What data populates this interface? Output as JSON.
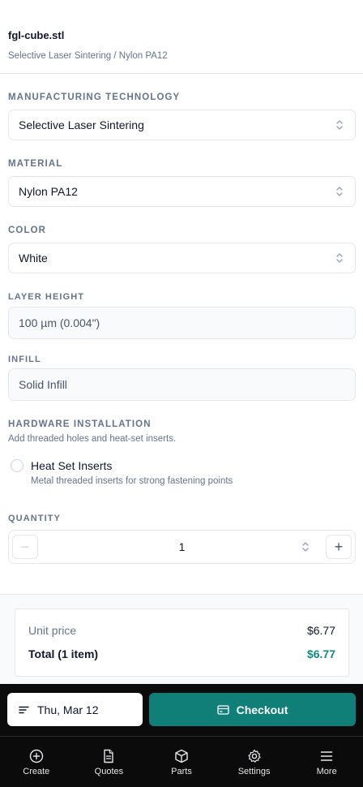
{
  "file": {
    "name": "fgl-cube.stl",
    "subtitle": "Selective Laser Sintering / Nylon PA12"
  },
  "fields": {
    "technology": {
      "label": "MANUFACTURING TECHNOLOGY",
      "value": "Selective Laser Sintering"
    },
    "material": {
      "label": "MATERIAL",
      "value": "Nylon PA12"
    },
    "color": {
      "label": "COLOR",
      "value": "White"
    },
    "layer_height": {
      "label": "LAYER HEIGHT",
      "value": "100 µm (0.004\")"
    },
    "infill": {
      "label": "INFILL",
      "value": "Solid Infill"
    }
  },
  "hardware": {
    "label": "HARDWARE INSTALLATION",
    "help": "Add threaded holes and heat-set inserts.",
    "option_title": "Heat Set Inserts",
    "option_desc": "Metal threaded inserts for strong fastening points",
    "checked": false
  },
  "quantity": {
    "label": "QUANTITY",
    "value": "1",
    "minus": "−",
    "plus": "+"
  },
  "summary": {
    "unit_price_label": "Unit price",
    "unit_price": "$6.77",
    "total_label": "Total (1 item)",
    "total": "$6.77"
  },
  "actions": {
    "date": "Thu, Mar 12",
    "checkout": "Checkout"
  },
  "nav": {
    "create": "Create",
    "quotes": "Quotes",
    "parts": "Parts",
    "settings": "Settings",
    "more": "More"
  },
  "colors": {
    "accent": "#0f7f77",
    "total": "#0f8a7e",
    "nav_bg": "#0b0b0b"
  }
}
